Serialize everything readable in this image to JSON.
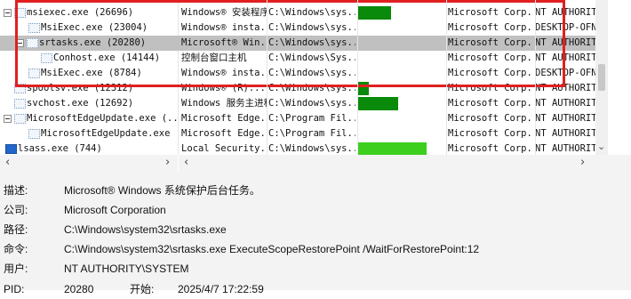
{
  "process_rows": [
    {
      "name": "msiexec.exe (26696)",
      "description": "Windows® 安装程序",
      "path": "C:\\Windows\\sys...",
      "company": "Microsoft Corp...",
      "user": "NT AUTHORITY\\",
      "cpu": 0.38,
      "cpu_color": "#0a8a0a",
      "selected": false,
      "icon": "process-icon"
    },
    {
      "name": "MsiExec.exe (23004)",
      "description": "Windows® insta...",
      "path": "C:\\Windows\\sys...",
      "company": "Microsoft Corp...",
      "user": "DESKTOP-OFNI",
      "cpu": 0,
      "cpu_color": "#0a8a0a",
      "selected": false,
      "icon": "process-icon"
    },
    {
      "name": "srtasks.exe (20280)",
      "description": "Microsoft® Win...",
      "path": "C:\\Windows\\sys...",
      "company": "Microsoft Corp...",
      "user": "NT AUTHORITY\\",
      "cpu": 0,
      "cpu_color": "#0a8a0a",
      "selected": true,
      "icon": "process-icon"
    },
    {
      "name": "Conhost.exe (14144)",
      "description": "控制台窗口主机",
      "path": "C:\\Windows\\Sys...",
      "company": "Microsoft Corp...",
      "user": "NT AUTHORITY\\",
      "cpu": 0,
      "cpu_color": "#0a8a0a",
      "selected": false,
      "icon": "process-icon"
    },
    {
      "name": "MsiExec.exe (8784)",
      "description": "Windows® insta...",
      "path": "C:\\Windows\\sys...",
      "company": "Microsoft Corp...",
      "user": "DESKTOP-OFNI",
      "cpu": 0,
      "cpu_color": "#0a8a0a",
      "selected": false,
      "icon": "process-icon"
    },
    {
      "name": "spoolsv.exe (12312)",
      "description": "Windows® (R)...",
      "path": "C:\\Windows\\sys...",
      "company": "Microsoft Corp...",
      "user": "NT AUTHORITY\\",
      "cpu": 0.13,
      "cpu_color": "#0a8a0a",
      "selected": false,
      "icon": "process-icon"
    },
    {
      "name": "svchost.exe (12692)",
      "description": "Windows 服务主进程",
      "path": "C:\\Windows\\sys...",
      "company": "Microsoft Corp...",
      "user": "NT AUTHORITY\\",
      "cpu": 0.46,
      "cpu_color": "#0a8a0a",
      "selected": false,
      "icon": "process-icon"
    },
    {
      "name": "MicrosoftEdgeUpdate.exe (...",
      "description": "Microsoft Edge...",
      "path": "C:\\Program Fil...",
      "company": "Microsoft Corp...",
      "user": "NT AUTHORITY\\",
      "cpu": 0,
      "cpu_color": "#0a8a0a",
      "selected": false,
      "icon": "process-icon"
    },
    {
      "name": "MicrosoftEdgeUpdate.exe",
      "description": "Microsoft Edge...",
      "path": "C:\\Program Fil...",
      "company": "Microsoft Corp...",
      "user": "NT AUTHORITY\\",
      "cpu": 0,
      "cpu_color": "#0a8a0a",
      "selected": false,
      "icon": "process-icon"
    },
    {
      "name": "lsass.exe (744)",
      "description": "Local Security...",
      "path": "C:\\Windows\\sys...",
      "company": "Microsoft Corp...",
      "user": "NT AUTHORITY\\",
      "cpu": 0.78,
      "cpu_color": "#3ccf1e",
      "selected": false,
      "icon": "process-icon-blue"
    }
  ],
  "details": {
    "description_label": "描述:",
    "description_value": "Microsoft® Windows 系统保护后台任务。",
    "company_label": "公司:",
    "company_value": "Microsoft Corporation",
    "path_label": "路径:",
    "path_value": "C:\\Windows\\system32\\srtasks.exe",
    "command_label": "命令:",
    "command_value": "C:\\Windows\\system32\\srtasks.exe ExecuteScopeRestorePoint /WaitForRestorePoint:12",
    "user_label": "用户:",
    "user_value": "NT AUTHORITY\\SYSTEM",
    "pid_label": "PID:",
    "pid_value": "20280",
    "start_label": "开始:",
    "start_value": "2025/4/7 17:22:59"
  },
  "scroll": {
    "left_arrow": "‹",
    "right_arrow": "›",
    "down_arrow": "⌄"
  }
}
